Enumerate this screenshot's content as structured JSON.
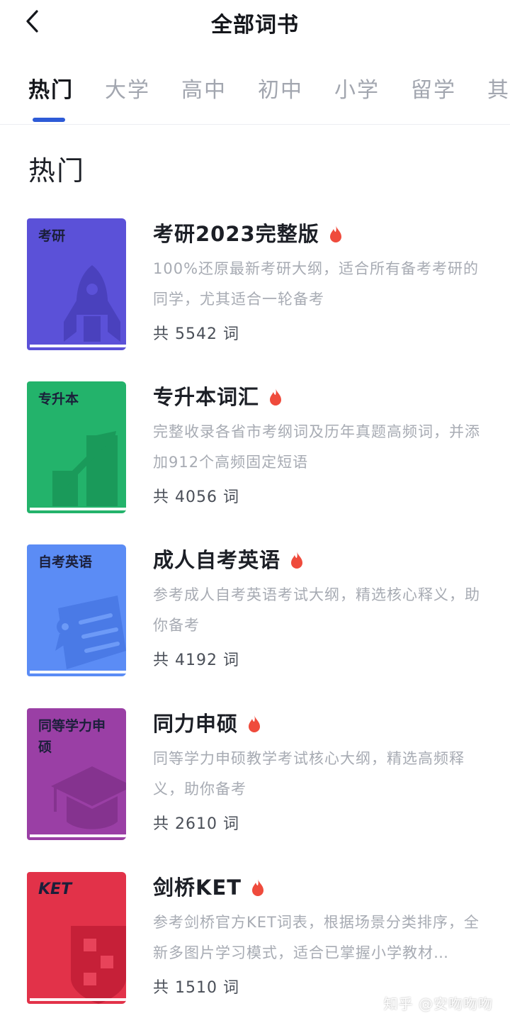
{
  "header": {
    "title": "全部词书"
  },
  "tabs": [
    {
      "label": "热门",
      "active": true
    },
    {
      "label": "大学"
    },
    {
      "label": "高中"
    },
    {
      "label": "初中"
    },
    {
      "label": "小学"
    },
    {
      "label": "留学"
    },
    {
      "label": "其他"
    }
  ],
  "section": {
    "title": "热门"
  },
  "books": [
    {
      "cover_label": "考研",
      "cover_color": "#5b51d8",
      "title": "考研2023完整版",
      "desc": "100%还原最新考研大纲，适合所有备考考研的同学，尤其适合一轮备考",
      "count": "共 5542 词",
      "hot_icon": "flame-icon"
    },
    {
      "cover_label": "专升本",
      "cover_color": "#23b36b",
      "title": "专升本词汇",
      "desc": "完整收录各省市考纲词及历年真题高频词，并添加912个高频固定短语",
      "count": "共 4056 词",
      "hot_icon": "flame-icon"
    },
    {
      "cover_label": "自考英语",
      "cover_color": "#5b8cf5",
      "title": "成人自考英语",
      "desc": "参考成人自考英语考试大纲，精选核心释义，助你备考",
      "count": "共 4192 词",
      "hot_icon": "flame-icon"
    },
    {
      "cover_label": "同等学力申硕",
      "cover_color": "#9a3fa5",
      "title": "同力申硕",
      "desc": "同等学力申硕教学考试核心大纲，精选高频释义，助你备考",
      "count": "共 2610 词",
      "hot_icon": "flame-icon"
    },
    {
      "cover_label": "KET",
      "cover_color": "#e23249",
      "title": "剑桥KET",
      "desc": "参考剑桥官方KET词表，根据场景分类排序，全新多图片学习模式，适合已掌握小学教材…",
      "count": "共 1510 词",
      "hot_icon": "flame-icon"
    }
  ],
  "watermark": "知乎 @安吻吻吻",
  "colors": {
    "accent": "#2e5bd7",
    "flame": "#ef4b3c"
  }
}
